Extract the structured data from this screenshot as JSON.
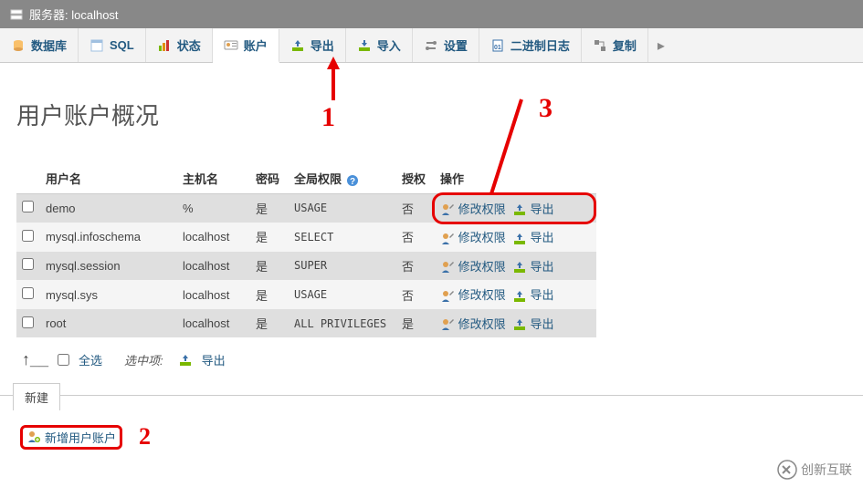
{
  "header": {
    "server_label": "服务器: localhost"
  },
  "tabs": [
    {
      "id": "database",
      "label": "数据库"
    },
    {
      "id": "sql",
      "label": "SQL"
    },
    {
      "id": "status",
      "label": "状态"
    },
    {
      "id": "accounts",
      "label": "账户"
    },
    {
      "id": "export",
      "label": "导出"
    },
    {
      "id": "import",
      "label": "导入"
    },
    {
      "id": "settings",
      "label": "设置"
    },
    {
      "id": "binlog",
      "label": "二进制日志"
    },
    {
      "id": "replication",
      "label": "复制"
    }
  ],
  "page_title": "用户账户概况",
  "columns": {
    "user": "用户名",
    "host": "主机名",
    "pw": "密码",
    "global": "全局权限",
    "grant": "授权",
    "action": "操作"
  },
  "rows": [
    {
      "user": "demo",
      "host": "%",
      "pw": "是",
      "global": "USAGE",
      "grant": "否"
    },
    {
      "user": "mysql.infoschema",
      "host": "localhost",
      "pw": "是",
      "global": "SELECT",
      "grant": "否"
    },
    {
      "user": "mysql.session",
      "host": "localhost",
      "pw": "是",
      "global": "SUPER",
      "grant": "否"
    },
    {
      "user": "mysql.sys",
      "host": "localhost",
      "pw": "是",
      "global": "USAGE",
      "grant": "否"
    },
    {
      "user": "root",
      "host": "localhost",
      "pw": "是",
      "global": "ALL PRIVILEGES",
      "grant": "是"
    }
  ],
  "actions": {
    "edit": "修改权限",
    "export": "导出"
  },
  "select_all": {
    "check_all": "全选",
    "with_selected": "选中项:",
    "export": "导出"
  },
  "new_section": {
    "legend": "新建",
    "add_user": "新增用户账户"
  },
  "annotations": {
    "a1": "1",
    "a2": "2",
    "a3": "3"
  },
  "footer": {
    "brand": "创新互联"
  }
}
